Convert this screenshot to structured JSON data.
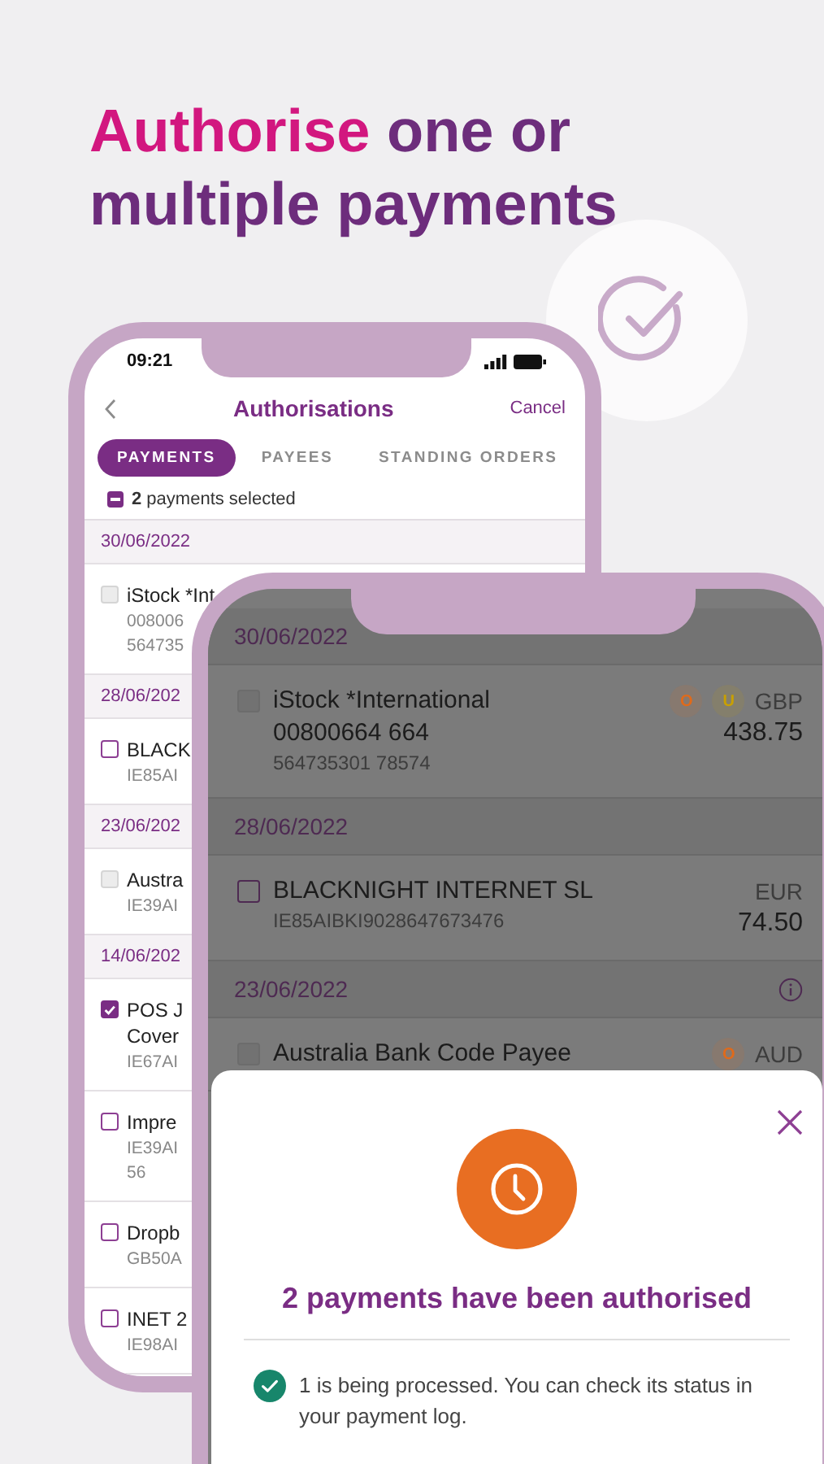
{
  "headline": [
    {
      "text": "Authorise",
      "kind": "accent"
    },
    {
      "text": "one or multiple payments",
      "kind": "plain"
    }
  ],
  "back_phone": {
    "status_bar": {
      "time": "09:21"
    },
    "nav": {
      "title": "Authorisations",
      "action": "Cancel"
    },
    "tabs": [
      {
        "label": "PAYMENTS",
        "selected": true
      },
      {
        "label": "PAYEES",
        "selected": false
      },
      {
        "label": "STANDING ORDERS",
        "selected": false
      }
    ],
    "selection": {
      "text": "**2** payments selected",
      "partial": true
    },
    "groups": [
      {
        "date": "30/06/2022",
        "rows": [
          {
            "lines": [
              "iStock *Int",
              "008006",
              "564735"
            ],
            "checked": false,
            "disabled": true
          }
        ]
      },
      {
        "date": "28/06/202",
        "rows": [
          {
            "lines": [
              "BLACK",
              "IE85AI"
            ],
            "checked": false,
            "disabled": false
          }
        ]
      },
      {
        "date": "23/06/202",
        "rows": [
          {
            "lines": [
              "Austra",
              "IE39AI"
            ],
            "checked": false,
            "disabled": true
          }
        ]
      },
      {
        "date": "14/06/202",
        "rows": [
          {
            "lines": [
              "POS J",
              "Cover",
              "IE67AI"
            ],
            "checked": true,
            "disabled": false
          },
          {
            "lines": [
              "Impre",
              "IE39AI",
              "56"
            ],
            "checked": false,
            "disabled": false
          },
          {
            "lines": [
              "Dropb",
              "GB50A"
            ],
            "checked": false,
            "disabled": false
          },
          {
            "lines": [
              "INET 2",
              "IE98AI"
            ],
            "checked": false,
            "disabled": false
          }
        ]
      }
    ]
  },
  "front_phone": {
    "groups": [
      {
        "date": "30/06/2022",
        "info": false,
        "rows": [
          {
            "name": "iStock *International",
            "reference": "00800664 664",
            "account": "564735301 78574",
            "checked": false,
            "disabled": true,
            "badges": [
              {
                "text": "O",
                "color": "#e06a1a"
              },
              {
                "text": "U",
                "color": "#c9a000"
              }
            ],
            "currency": "GBP",
            "amount": "438.75"
          }
        ]
      },
      {
        "date": "28/06/2022",
        "info": false,
        "rows": [
          {
            "name": "BLACKNIGHT INTERNET SL",
            "account": "IE85AIBKI9028647673476",
            "checked": false,
            "disabled": false,
            "badges": [],
            "currency": "EUR",
            "amount": "74.50"
          }
        ]
      },
      {
        "date": "23/06/2022",
        "info": true,
        "rows": [
          {
            "name": "Australia Bank Code Payee",
            "checked": false,
            "disabled": true,
            "badges": [
              {
                "text": "O",
                "color": "#e06a1a"
              }
            ],
            "currency": "AUD"
          }
        ]
      }
    ],
    "sheet": {
      "title": "2 payments have been authorised",
      "status": "1 is being processed. You can check its status in your payment log."
    }
  }
}
